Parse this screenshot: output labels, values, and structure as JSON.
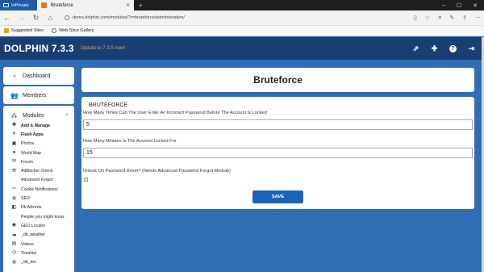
{
  "browser": {
    "inprivate_label": "InPrivate",
    "tab_title": "Bruteforce",
    "tab_close": "✕",
    "new_tab": "+",
    "url": "demo.dolphin.com/modules/?r=bruteforce/administration/",
    "favorites": [
      {
        "label": "Suggested Sites"
      },
      {
        "label": "Web Slice Gallery"
      }
    ]
  },
  "app": {
    "logo": "DOLPHIN 7.3.3",
    "update_notice": "Update to 7.3.5 now!"
  },
  "sidebar": {
    "dashboard": "Dashboard",
    "members": "Members",
    "modules": "Modules",
    "module_items": [
      {
        "label": "Add & Manage",
        "icon": "plus-icon",
        "bold": true
      },
      {
        "label": "Flash Apps",
        "icon": "flash-icon",
        "bold": true
      },
      {
        "label": "Photos",
        "icon": "photo-icon",
        "bold": false
      },
      {
        "label": "World Map",
        "icon": "map-pin-icon",
        "bold": false
      },
      {
        "label": "Forum",
        "icon": "comments-icon",
        "bold": false
      },
      {
        "label": "Adblocker Check",
        "icon": "gavel-icon",
        "bold": false
      },
      {
        "label": "Advanced Forgot",
        "icon": "",
        "bold": false
      },
      {
        "label": "Cookie Notifications",
        "icon": "wrench-icon",
        "bold": false
      },
      {
        "label": "SEO",
        "icon": "globe-icon",
        "bold": false
      },
      {
        "label": "Db Adverts",
        "icon": "db-adverts-icon",
        "bold": false
      },
      {
        "label": "People you might know",
        "icon": "",
        "bold": false
      },
      {
        "label": "GEO Locator",
        "icon": "geo-icon",
        "bold": false
      },
      {
        "label": "_db_weather",
        "icon": "weather-icon",
        "bold": false
      },
      {
        "label": "Videos",
        "icon": "film-icon",
        "bold": false
      },
      {
        "label": "Timeline",
        "icon": "clock-icon",
        "bold": false
      },
      {
        "label": "_db_dm",
        "icon": "dm-icon",
        "bold": false
      }
    ]
  },
  "main": {
    "page_title": "Bruteforce",
    "fieldset_title": "BRUTEFORCE",
    "field1_label": "How Many Times Can The User Enter An Incorrect Password Before The Account Is Locked",
    "field1_value": "5",
    "field2_label": "How Many Minutes Is The Account Locked For",
    "field2_value": "15",
    "field3_label": "Unlock On Password Reset? (Needs Advanced Password Forgot Module)",
    "save_label": "SAVE"
  }
}
